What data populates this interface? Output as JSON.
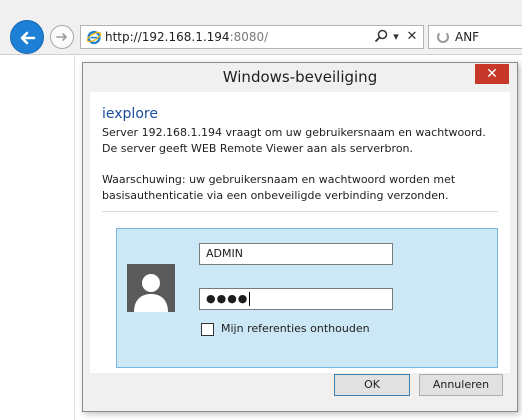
{
  "browser": {
    "url_host": "http://192.168.1.194",
    "url_port": ":8080/",
    "search_icon": "search-icon",
    "dropdown_glyph": "▾",
    "close_glyph": "✕",
    "tab_label": "ANF"
  },
  "dialog": {
    "title": "Windows-beveiliging",
    "close_glyph": "✕",
    "app_name": "iexplore",
    "message": "Server 192.168.1.194 vraagt om uw gebruikersnaam en wachtwoord. De server geeft WEB Remote Viewer aan als serverbron.",
    "warning": "Waarschuwing: uw gebruikersnaam en wachtwoord worden met basisauthenticatie via een onbeveiligde verbinding verzonden.",
    "username_value": "ADMIN",
    "password_mask": "●●●●",
    "remember_label": "Mijn referenties onthouden",
    "remember_checked": false,
    "ok_label": "OK",
    "cancel_label": "Annuleren"
  },
  "colors": {
    "accent": "#1e7fd6",
    "close_red": "#c7372a",
    "panel_bg": "#cce8f7",
    "link_blue": "#1a4e9c"
  }
}
